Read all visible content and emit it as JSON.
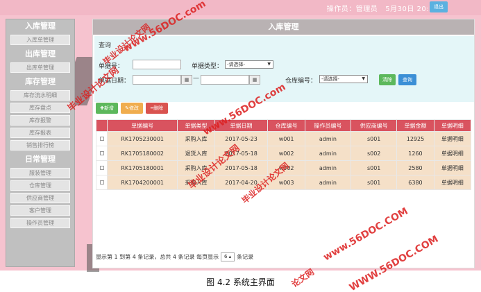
{
  "header": {
    "operator_label": "操作员：",
    "operator_name": "管理员",
    "date_time": "5月30日 20:2",
    "exit_label": "退出"
  },
  "sidebar": {
    "sections": [
      {
        "title": "入库管理",
        "items": [
          "入库单管理"
        ]
      },
      {
        "title": "出库管理",
        "items": [
          "出库单管理"
        ]
      },
      {
        "title": "库存管理",
        "items": [
          "库存流水明细",
          "库存盘点",
          "库存报警",
          "库存报表",
          "销售排行榜"
        ]
      },
      {
        "title": "日常管理",
        "items": [
          "服装管理",
          "仓库管理",
          "供应商管理",
          "客户管理",
          "操作员管理"
        ]
      }
    ]
  },
  "main": {
    "title": "入库管理",
    "search": {
      "title": "查询",
      "labels": {
        "doc_no": "单据号：",
        "doc_type": "单据类型：",
        "doc_date": "单据日期：",
        "warehouse": "仓库编号："
      },
      "doc_type_value": "-请选择-",
      "warehouse_value": "-请选择-",
      "date_sep": "—",
      "clear_label": "清除",
      "query_label": "查询"
    },
    "toolbar": {
      "add": "新增",
      "edit": "修改",
      "delete": "删除"
    },
    "table": {
      "headers": [
        "单据编号",
        "单据类型",
        "单据日期",
        "仓库编号",
        "操作员编号",
        "供应商编号",
        "单据金额",
        "单据明细"
      ],
      "rows": [
        [
          "RK1705230001",
          "采购入库",
          "2017-05-23",
          "w001",
          "admin",
          "s001",
          "12925",
          "单据明细"
        ],
        [
          "RK1705180002",
          "退货入库",
          "2017-05-18",
          "w002",
          "admin",
          "s002",
          "1260",
          "单据明细"
        ],
        [
          "RK1705180001",
          "采购入库",
          "2017-05-18",
          "w002",
          "admin",
          "s001",
          "2580",
          "单据明细"
        ],
        [
          "RK1704200001",
          "采购入库",
          "2017-04-20",
          "w003",
          "admin",
          "s001",
          "6380",
          "单据明细"
        ]
      ]
    },
    "pager": {
      "text_before": "显示第 1 到第 4 条记录，总共 4 条记录 每页显示",
      "page_size": "6",
      "text_after": "条记录"
    }
  },
  "caption": "图 4.2 系统主界面",
  "watermarks": [
    "毕业设计论文网",
    "www.56DOC.com",
    "毕业设计论文网",
    "www.56DOC.com",
    "毕业设计论文网",
    "www.56DOC.COM",
    "毕业设计论文网",
    "WWW.56DOC.COM",
    "论文网"
  ],
  "colors": {
    "table_header": "#d9535f",
    "row_bg": "#f5e0c8",
    "add_button": "#5cb85c",
    "edit_button": "#f0ad4e",
    "delete_button": "#d9534f",
    "query_button": "#3b8fd6"
  }
}
